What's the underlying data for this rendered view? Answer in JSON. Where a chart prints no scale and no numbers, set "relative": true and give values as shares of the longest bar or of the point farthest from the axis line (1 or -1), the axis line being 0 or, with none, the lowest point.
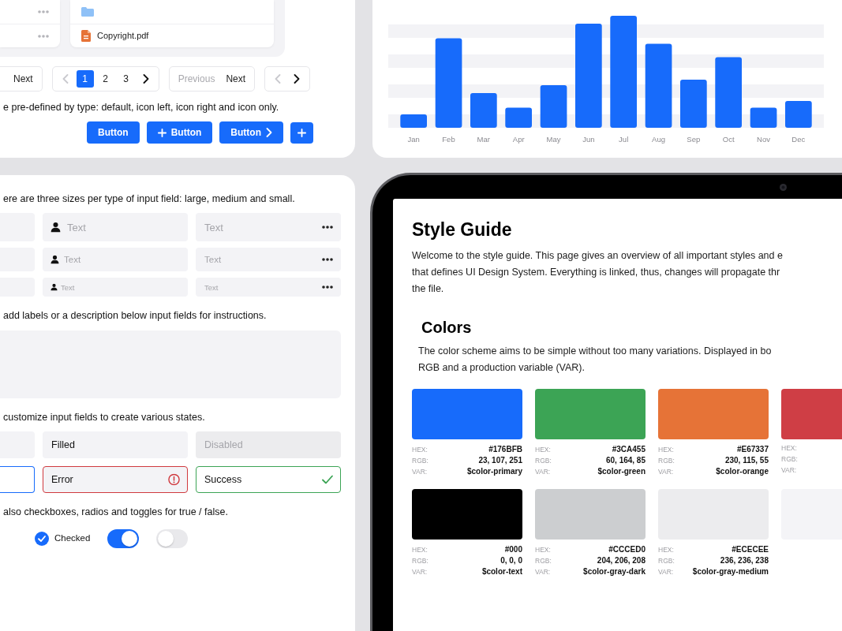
{
  "files_panel": {
    "files": [
      {
        "kind": "folder"
      },
      {
        "kind": "pdf",
        "name": "Copyright.pdf"
      }
    ],
    "pagination": [
      {
        "items": [
          {
            "kind": "text",
            "label": "Next",
            "disabled": false
          }
        ]
      },
      {
        "items": [
          {
            "kind": "prev",
            "disabled": true
          },
          {
            "kind": "page",
            "label": "1",
            "selected": true
          },
          {
            "kind": "page",
            "label": "2",
            "selected": false
          },
          {
            "kind": "page",
            "label": "3",
            "selected": false
          },
          {
            "kind": "next",
            "disabled": false
          }
        ]
      },
      {
        "items": [
          {
            "kind": "text",
            "label": "Previous",
            "disabled": true
          },
          {
            "kind": "text",
            "label": "Next",
            "disabled": false
          }
        ]
      },
      {
        "items": [
          {
            "kind": "prev",
            "disabled": true
          },
          {
            "kind": "next",
            "disabled": false
          }
        ]
      }
    ],
    "buttons_note": "e pre-defined by type: default, icon left, icon right and icon only.",
    "buttons": [
      {
        "kind": "default",
        "label": "Button"
      },
      {
        "kind": "icon_left",
        "label": "Button"
      },
      {
        "kind": "icon_right",
        "label": "Button"
      },
      {
        "kind": "icon_only"
      }
    ]
  },
  "chart_panel": {
    "chart_data": {
      "type": "bar",
      "relative": true,
      "categories": [
        "Jan",
        "Feb",
        "Mar",
        "Apr",
        "May",
        "Jun",
        "Jul",
        "Aug",
        "Sep",
        "Oct",
        "Nov",
        "Dec"
      ],
      "values": [
        0.12,
        0.8,
        0.31,
        0.18,
        0.38,
        0.93,
        1,
        0.75,
        0.43,
        0.63,
        0.18,
        0.24
      ]
    }
  },
  "form_panel": {
    "sizes_note": "ere are three sizes per type of input field: large, medium and small.",
    "field_columns": [
      {
        "kind": "plain",
        "fields": [
          {
            "kind": "large"
          },
          {
            "kind": "medium"
          },
          {
            "kind": "small"
          }
        ]
      },
      {
        "kind": "icon_left",
        "fields": [
          {
            "kind": "large",
            "placeholder": "Text"
          },
          {
            "kind": "medium",
            "placeholder": "Text"
          },
          {
            "kind": "small",
            "placeholder": "Text"
          }
        ]
      },
      {
        "kind": "icon_right",
        "fields": [
          {
            "kind": "large",
            "placeholder": "Text"
          },
          {
            "kind": "medium",
            "placeholder": "Text"
          },
          {
            "kind": "small",
            "placeholder": "Text"
          }
        ]
      }
    ],
    "labels_note": "add labels or a description below input fields for instructions.",
    "states_note": "customize input fields to create various states.",
    "state_fields": [
      {
        "kind": "default"
      },
      {
        "kind": "filled",
        "value": "Filled"
      },
      {
        "kind": "disabled",
        "placeholder": "Disabled"
      },
      {
        "kind": "focused"
      },
      {
        "kind": "error",
        "value": "Error"
      },
      {
        "kind": "success",
        "value": "Success"
      }
    ],
    "toggles_note": "also checkboxes, radios and toggles for true / false.",
    "controls": [
      {
        "kind": "checkbox",
        "label": "Checked",
        "checked": true
      },
      {
        "kind": "toggle",
        "on": true
      },
      {
        "kind": "toggle",
        "on": false
      }
    ]
  },
  "tablet": {
    "title": "Style Guide",
    "intro_lines": [
      "Welcome to the style guide. This page gives an overview of all important styles and e",
      "that defines UI Design System. Everything is linked, thus, changes will propagate thr",
      "the file."
    ],
    "colors_heading": "Colors",
    "colors_intro_lines": [
      "The color scheme aims to be simple without too many variations. Displayed in bo",
      "RGB and a production variable (VAR)."
    ],
    "swatches": [
      {
        "color": "#176bfb",
        "labels": [
          "HEX:",
          "RGB:",
          "VAR:"
        ],
        "hex": "#176BFB",
        "rgb": "23, 107, 251",
        "var": "$color-primary"
      },
      {
        "color": "#3ca455",
        "labels": [
          "HEX:",
          "RGB:",
          "VAR:"
        ],
        "hex": "#3CA455",
        "rgb": "60, 164, 85",
        "var": "$color-green"
      },
      {
        "color": "#e67337",
        "labels": [
          "HEX:",
          "RGB:",
          "VAR:"
        ],
        "hex": "#E67337",
        "rgb": "230, 115, 55",
        "var": "$color-orange"
      },
      {
        "color": "#cf3e45",
        "labels": [
          "HEX:",
          "RGB:",
          "VAR:"
        ]
      },
      {
        "color": "#000000",
        "labels": [
          "HEX:",
          "RGB:",
          "VAR:"
        ],
        "hex": "#000",
        "rgb": "0, 0, 0",
        "var": "$color-text"
      },
      {
        "color": "#ccced0",
        "labels": [
          "HEX:",
          "RGB:",
          "VAR:"
        ],
        "hex": "#CCCED0",
        "rgb": "204, 206, 208",
        "var": "$color-gray-dark"
      },
      {
        "color": "#ececee",
        "labels": [
          "HEX:",
          "RGB:",
          "VAR:"
        ],
        "hex": "#ECECEE",
        "rgb": "236, 236, 238",
        "var": "$color-gray-medium"
      },
      {
        "color": "#f4f4f7"
      }
    ]
  }
}
